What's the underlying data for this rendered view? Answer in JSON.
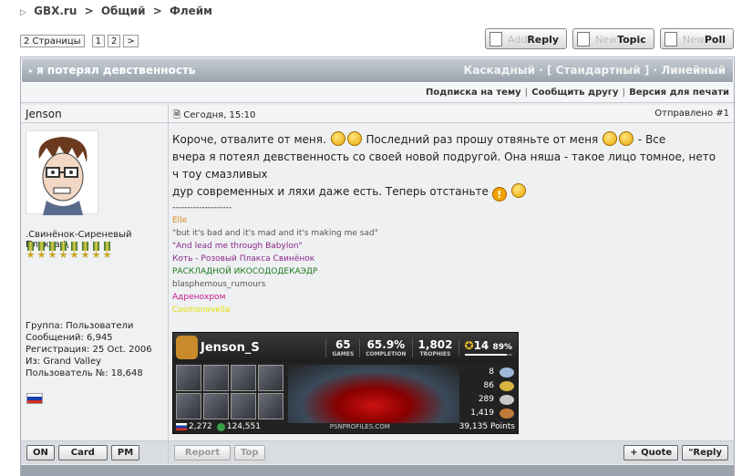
{
  "breadcrumb": {
    "items": [
      "GBX.ru",
      ">",
      "Общий",
      ">",
      "Флейм"
    ]
  },
  "pager": {
    "label": "2 Страницы",
    "pages": [
      "1",
      "2"
    ],
    "next": ">"
  },
  "topbuttons": {
    "reply_ghost": "Add",
    "reply": "Reply",
    "topic_ghost": "New",
    "topic": "Topic",
    "poll_ghost": "New",
    "poll": "Poll"
  },
  "topic": {
    "title": "я потерял девственность",
    "modes": "Каскадный · [ Стандартный ] · Линейный"
  },
  "links": [
    "Подписка на тему",
    "Сообщить другу",
    "Версия для печати"
  ],
  "user": {
    "name": "Jenson",
    "title": ".Свинёнок-Сиреневый Плакса:'\\",
    "info": [
      "Группа: Пользователи",
      "Сообщений: 6,945",
      "Регистрация: 25 Oct. 2006",
      "Из: Grand Valley",
      "Пользователь №: 18,648"
    ]
  },
  "post": {
    "date": "Сегодня, 15:10",
    "num": "Отправлено #1",
    "line1a": "Короче, отвалите от меня.",
    "line1b": "Последний раз прошу отвяньте от меня",
    "line1c": "- Все",
    "line2": "вчера я потеял девственность со своей новой подругой. Она няша - такое лицо томное, нето ч тоу смазливых",
    "line3": "дур современных и ляхи даже есть. Теперь отстаньте"
  },
  "signature": {
    "sep": "--------------------",
    "l1": "Elle",
    "l2": "\"but it's bad and it's mad and it's making me sad\"",
    "l3": "\"And lead me through Babylon\"",
    "l4": "Коть - Розовый Плакса Свинёнок",
    "l5": "РАСКЛАДНОЙ ИКОСОДОДЕКАЭДР",
    "l6": "blasphemous_rumours",
    "l7": "Адренохром",
    "l8": "Cosmonovella",
    "colors": {
      "l1": "#e08a1e",
      "l3": "#8a2a8a",
      "l4": "#8a2a8a",
      "l5": "#1e7a1e",
      "l6": "#555555",
      "l7": "#c0198a",
      "l8": "#e8e000"
    }
  },
  "psn": {
    "name": "Jenson_S",
    "games": "65",
    "games_lbl": "GAMES",
    "completion": "65.9%",
    "completion_lbl": "COMPLETION",
    "trophies": "1,802",
    "trophies_lbl": "TROPHIES",
    "level": "14",
    "level_pct": "89%",
    "level_fill": 0.89,
    "counts": [
      "8",
      "86",
      "289",
      "1,419"
    ],
    "stat1": "2,272",
    "stat2": "124,551",
    "site": "PSNPROFILES.COM",
    "points": "39,135 Points"
  },
  "footer": {
    "on": "ON",
    "card": "Card",
    "pm": "PM",
    "report": "Report",
    "top": "Top",
    "quote": "+ Quote",
    "reply": "\"Reply"
  }
}
